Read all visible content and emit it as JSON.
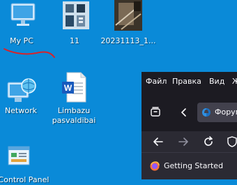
{
  "desktop": {
    "icons": [
      {
        "label": "My PC"
      },
      {
        "label": "11"
      },
      {
        "label": "20231113_1..."
      },
      {
        "label": "Network"
      },
      {
        "label": "Limbazu pasvaldibai"
      },
      {
        "label": "Control Panel"
      }
    ]
  },
  "browser": {
    "menu": [
      "Файл",
      "Правка",
      "Вид",
      "Ж"
    ],
    "tab_title": "Форум",
    "bookmark": "Getting Started"
  },
  "colors": {
    "desktop_bg": "#0a8ad8",
    "browser_bg": "#2b2a33",
    "browser_frame": "#1c1b22",
    "annotation": "#d8232a"
  }
}
